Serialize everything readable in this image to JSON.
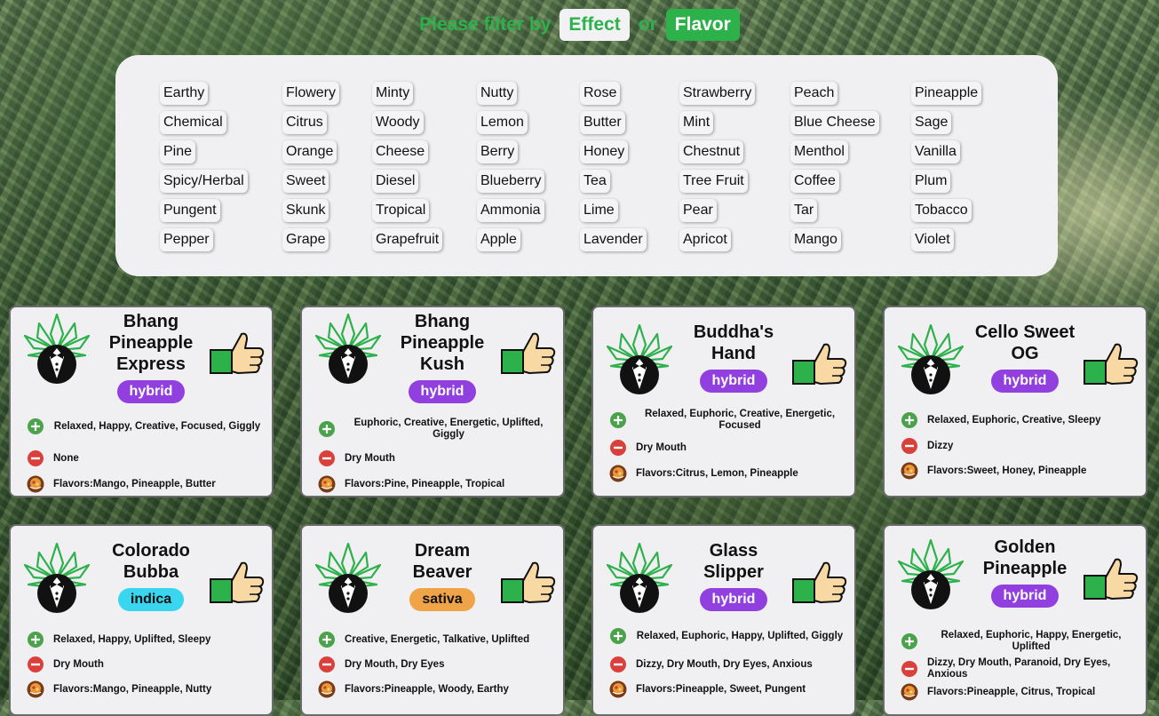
{
  "filter": {
    "prompt": "Please filter by",
    "effect_label": "Effect",
    "or_label": "or",
    "flavor_label": "Flavor"
  },
  "flavors": [
    [
      "Earthy",
      "Chemical",
      "Pine",
      "Spicy/Herbal",
      "Pungent",
      "Pepper"
    ],
    [
      "Flowery",
      "Citrus",
      "Orange",
      "Sweet",
      "Skunk",
      "Grape"
    ],
    [
      "Minty",
      "Woody",
      "Cheese",
      "Diesel",
      "Tropical",
      "Grapefruit"
    ],
    [
      "Nutty",
      "Lemon",
      "Berry",
      "Blueberry",
      "Ammonia",
      "Apple"
    ],
    [
      "Rose",
      "Butter",
      "Honey",
      "Tea",
      "Lime",
      "Lavender"
    ],
    [
      "Strawberry",
      "Mint",
      "Chestnut",
      "Tree Fruit",
      "Pear",
      "Apricot"
    ],
    [
      "Peach",
      "Blue Cheese",
      "Menthol",
      "Coffee",
      "Tar",
      "Mango"
    ],
    [
      "Pineapple",
      "Sage",
      "Vanilla",
      "Plum",
      "Tobacco",
      "Violet"
    ]
  ],
  "strains": [
    {
      "name": "Bhang Pineapple Express",
      "type": "hybrid",
      "effects": "Relaxed, Happy, Creative, Focused, Giggly",
      "negatives": "None",
      "flavors": "Flavors:Mango, Pineapple, Butter"
    },
    {
      "name": "Bhang Pineapple Kush",
      "type": "hybrid",
      "effects": "Euphoric, Creative, Energetic, Uplifted, Giggly",
      "negatives": "Dry Mouth",
      "flavors": "Flavors:Pine, Pineapple, Tropical"
    },
    {
      "name": "Buddha's Hand",
      "type": "hybrid",
      "effects": "Relaxed, Euphoric, Creative, Energetic, Focused",
      "negatives": "Dry Mouth",
      "flavors": "Flavors:Citrus, Lemon, Pineapple"
    },
    {
      "name": "Cello Sweet OG",
      "type": "hybrid",
      "effects": "Relaxed, Euphoric, Creative, Sleepy",
      "negatives": "Dizzy",
      "flavors": "Flavors:Sweet, Honey, Pineapple"
    },
    {
      "name": "Colorado Bubba",
      "type": "indica",
      "effects": "Relaxed, Happy, Uplifted, Sleepy",
      "negatives": "Dry Mouth",
      "flavors": "Flavors:Mango, Pineapple, Nutty"
    },
    {
      "name": "Dream Beaver",
      "type": "sativa",
      "effects": "Creative, Energetic, Talkative, Uplifted",
      "negatives": "Dry Mouth, Dry Eyes",
      "flavors": "Flavors:Pineapple, Woody, Earthy"
    },
    {
      "name": "Glass Slipper",
      "type": "hybrid",
      "effects": "Relaxed, Euphoric, Happy, Uplifted, Giggly",
      "negatives": "Dizzy, Dry Mouth, Dry Eyes, Anxious",
      "flavors": "Flavors:Pineapple, Sweet, Pungent"
    },
    {
      "name": "Golden Pineapple",
      "type": "hybrid",
      "effects": "Relaxed, Euphoric, Happy, Energetic, Uplifted",
      "negatives": "Dizzy, Dry Mouth, Paranoid, Dry Eyes, Anxious",
      "flavors": "Flavors:Pineapple, Citrus, Tropical"
    }
  ],
  "colors": {
    "accent_green": "#2db14b",
    "hybrid": "#9140df",
    "indica": "#3ad6ef",
    "sativa": "#f0a448",
    "panel": "#f0f0f3"
  },
  "icons": {
    "positive": "plus-circle-icon",
    "negative": "minus-circle-icon",
    "flavor": "flavor-bowl-icon",
    "logo": "cannabis-leaf-tuxedo-icon",
    "rate": "thumbs-up-icon"
  }
}
